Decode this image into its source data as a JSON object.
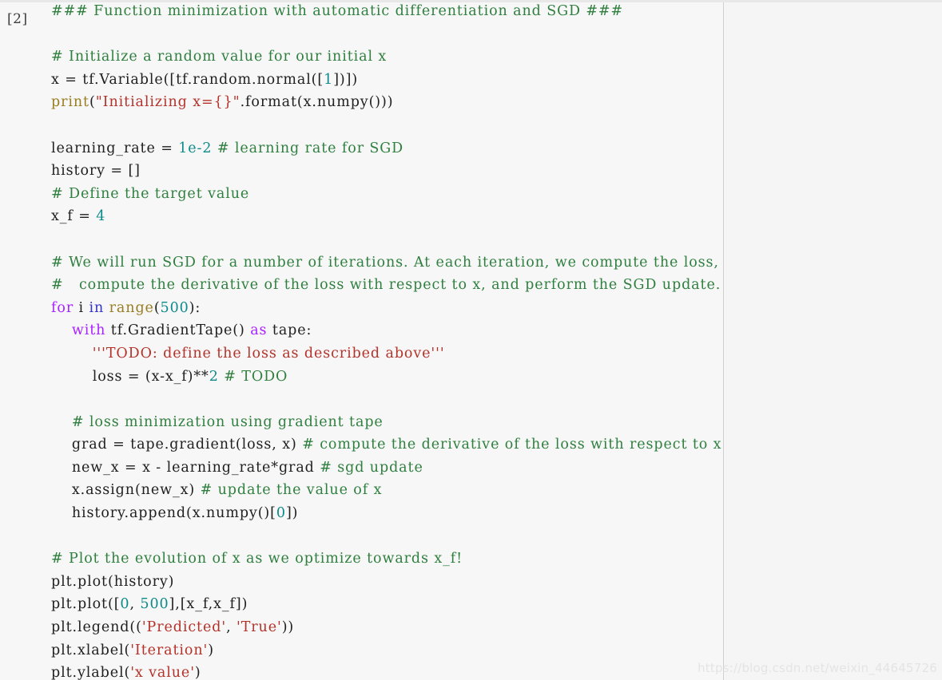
{
  "cell": {
    "execution_prompt": "[2]",
    "language": "python",
    "background_color": "#f7f7f7",
    "page_background_color": "#f5f5f5",
    "divider_color": "#cfcfcf"
  },
  "colors": {
    "comment": "#2f7f3f",
    "string": "#b3332b",
    "keyword": "#aa22ff",
    "keyword_in": "#3333cc",
    "builtin": "#9a7d22",
    "number": "#0d8a8a",
    "plain": "#202020",
    "watermark": "#e4e4e4"
  },
  "watermark": {
    "text": "https://blog.csdn.net/weixin_44645726"
  },
  "code": {
    "lines": [
      {
        "id": 1,
        "tokens": [
          {
            "t": "comment",
            "s": "### Function minimization with automatic differentiation and SGD ###"
          }
        ]
      },
      {
        "id": 2,
        "tokens": [
          {
            "t": "plain",
            "s": ""
          }
        ]
      },
      {
        "id": 3,
        "tokens": [
          {
            "t": "comment",
            "s": "# Initialize a random value for our initial x"
          }
        ]
      },
      {
        "id": 4,
        "tokens": [
          {
            "t": "plain",
            "s": "x = tf.Variable([tf.random.normal(["
          },
          {
            "t": "number",
            "s": "1"
          },
          {
            "t": "plain",
            "s": "])])"
          }
        ]
      },
      {
        "id": 5,
        "tokens": [
          {
            "t": "builtin",
            "s": "print"
          },
          {
            "t": "plain",
            "s": "("
          },
          {
            "t": "string",
            "s": "\"Initializing x={}\""
          },
          {
            "t": "plain",
            "s": ".format(x.numpy()))"
          }
        ]
      },
      {
        "id": 6,
        "tokens": [
          {
            "t": "plain",
            "s": ""
          }
        ]
      },
      {
        "id": 7,
        "tokens": [
          {
            "t": "plain",
            "s": "learning_rate = "
          },
          {
            "t": "number",
            "s": "1e-2"
          },
          {
            "t": "plain",
            "s": " "
          },
          {
            "t": "comment",
            "s": "# learning rate for SGD"
          }
        ]
      },
      {
        "id": 8,
        "tokens": [
          {
            "t": "plain",
            "s": "history = []"
          }
        ]
      },
      {
        "id": 9,
        "tokens": [
          {
            "t": "comment",
            "s": "# Define the target value"
          }
        ]
      },
      {
        "id": 10,
        "tokens": [
          {
            "t": "plain",
            "s": "x_f = "
          },
          {
            "t": "number",
            "s": "4"
          }
        ]
      },
      {
        "id": 11,
        "tokens": [
          {
            "t": "plain",
            "s": ""
          }
        ]
      },
      {
        "id": 12,
        "tokens": [
          {
            "t": "comment",
            "s": "# We will run SGD for a number of iterations. At each iteration, we compute the loss,"
          }
        ]
      },
      {
        "id": 13,
        "tokens": [
          {
            "t": "comment",
            "s": "#   compute the derivative of the loss with respect to x, and perform the SGD update."
          }
        ]
      },
      {
        "id": 14,
        "tokens": [
          {
            "t": "keyword",
            "s": "for"
          },
          {
            "t": "plain",
            "s": " i "
          },
          {
            "t": "keyword_in",
            "s": "in"
          },
          {
            "t": "plain",
            "s": " "
          },
          {
            "t": "builtin",
            "s": "range"
          },
          {
            "t": "plain",
            "s": "("
          },
          {
            "t": "number",
            "s": "500"
          },
          {
            "t": "plain",
            "s": "):"
          }
        ]
      },
      {
        "id": 15,
        "tokens": [
          {
            "t": "plain",
            "s": "    "
          },
          {
            "t": "keyword",
            "s": "with"
          },
          {
            "t": "plain",
            "s": " tf.GradientTape() "
          },
          {
            "t": "keyword",
            "s": "as"
          },
          {
            "t": "plain",
            "s": " tape:"
          }
        ]
      },
      {
        "id": 16,
        "tokens": [
          {
            "t": "plain",
            "s": "        "
          },
          {
            "t": "string",
            "s": "'''TODO: define the loss as described above'''"
          }
        ]
      },
      {
        "id": 17,
        "tokens": [
          {
            "t": "plain",
            "s": "        loss = (x-x_f)**"
          },
          {
            "t": "number",
            "s": "2"
          },
          {
            "t": "plain",
            "s": " "
          },
          {
            "t": "comment",
            "s": "# TODO"
          }
        ]
      },
      {
        "id": 18,
        "tokens": [
          {
            "t": "plain",
            "s": ""
          }
        ]
      },
      {
        "id": 19,
        "tokens": [
          {
            "t": "plain",
            "s": "    "
          },
          {
            "t": "comment",
            "s": "# loss minimization using gradient tape"
          }
        ]
      },
      {
        "id": 20,
        "tokens": [
          {
            "t": "plain",
            "s": "    grad = tape.gradient(loss, x) "
          },
          {
            "t": "comment",
            "s": "# compute the derivative of the loss with respect to x"
          }
        ]
      },
      {
        "id": 21,
        "tokens": [
          {
            "t": "plain",
            "s": "    new_x = x - learning_rate*grad "
          },
          {
            "t": "comment",
            "s": "# sgd update"
          }
        ]
      },
      {
        "id": 22,
        "tokens": [
          {
            "t": "plain",
            "s": "    x.assign(new_x) "
          },
          {
            "t": "comment",
            "s": "# update the value of x"
          }
        ]
      },
      {
        "id": 23,
        "tokens": [
          {
            "t": "plain",
            "s": "    history.append(x.numpy()["
          },
          {
            "t": "number",
            "s": "0"
          },
          {
            "t": "plain",
            "s": "])"
          }
        ]
      },
      {
        "id": 24,
        "tokens": [
          {
            "t": "plain",
            "s": ""
          }
        ]
      },
      {
        "id": 25,
        "tokens": [
          {
            "t": "comment",
            "s": "# Plot the evolution of x as we optimize towards x_f!"
          }
        ]
      },
      {
        "id": 26,
        "tokens": [
          {
            "t": "plain",
            "s": "plt.plot(history)"
          }
        ]
      },
      {
        "id": 27,
        "tokens": [
          {
            "t": "plain",
            "s": "plt.plot(["
          },
          {
            "t": "number",
            "s": "0"
          },
          {
            "t": "plain",
            "s": ", "
          },
          {
            "t": "number",
            "s": "500"
          },
          {
            "t": "plain",
            "s": "],[x_f,x_f])"
          }
        ]
      },
      {
        "id": 28,
        "tokens": [
          {
            "t": "plain",
            "s": "plt.legend(("
          },
          {
            "t": "string",
            "s": "'Predicted'"
          },
          {
            "t": "plain",
            "s": ", "
          },
          {
            "t": "string",
            "s": "'True'"
          },
          {
            "t": "plain",
            "s": "))"
          }
        ]
      },
      {
        "id": 29,
        "tokens": [
          {
            "t": "plain",
            "s": "plt.xlabel("
          },
          {
            "t": "string",
            "s": "'Iteration'"
          },
          {
            "t": "plain",
            "s": ")"
          }
        ]
      },
      {
        "id": 30,
        "tokens": [
          {
            "t": "plain",
            "s": "plt.ylabel("
          },
          {
            "t": "string",
            "s": "'x value'"
          },
          {
            "t": "plain",
            "s": ")"
          }
        ]
      }
    ]
  }
}
